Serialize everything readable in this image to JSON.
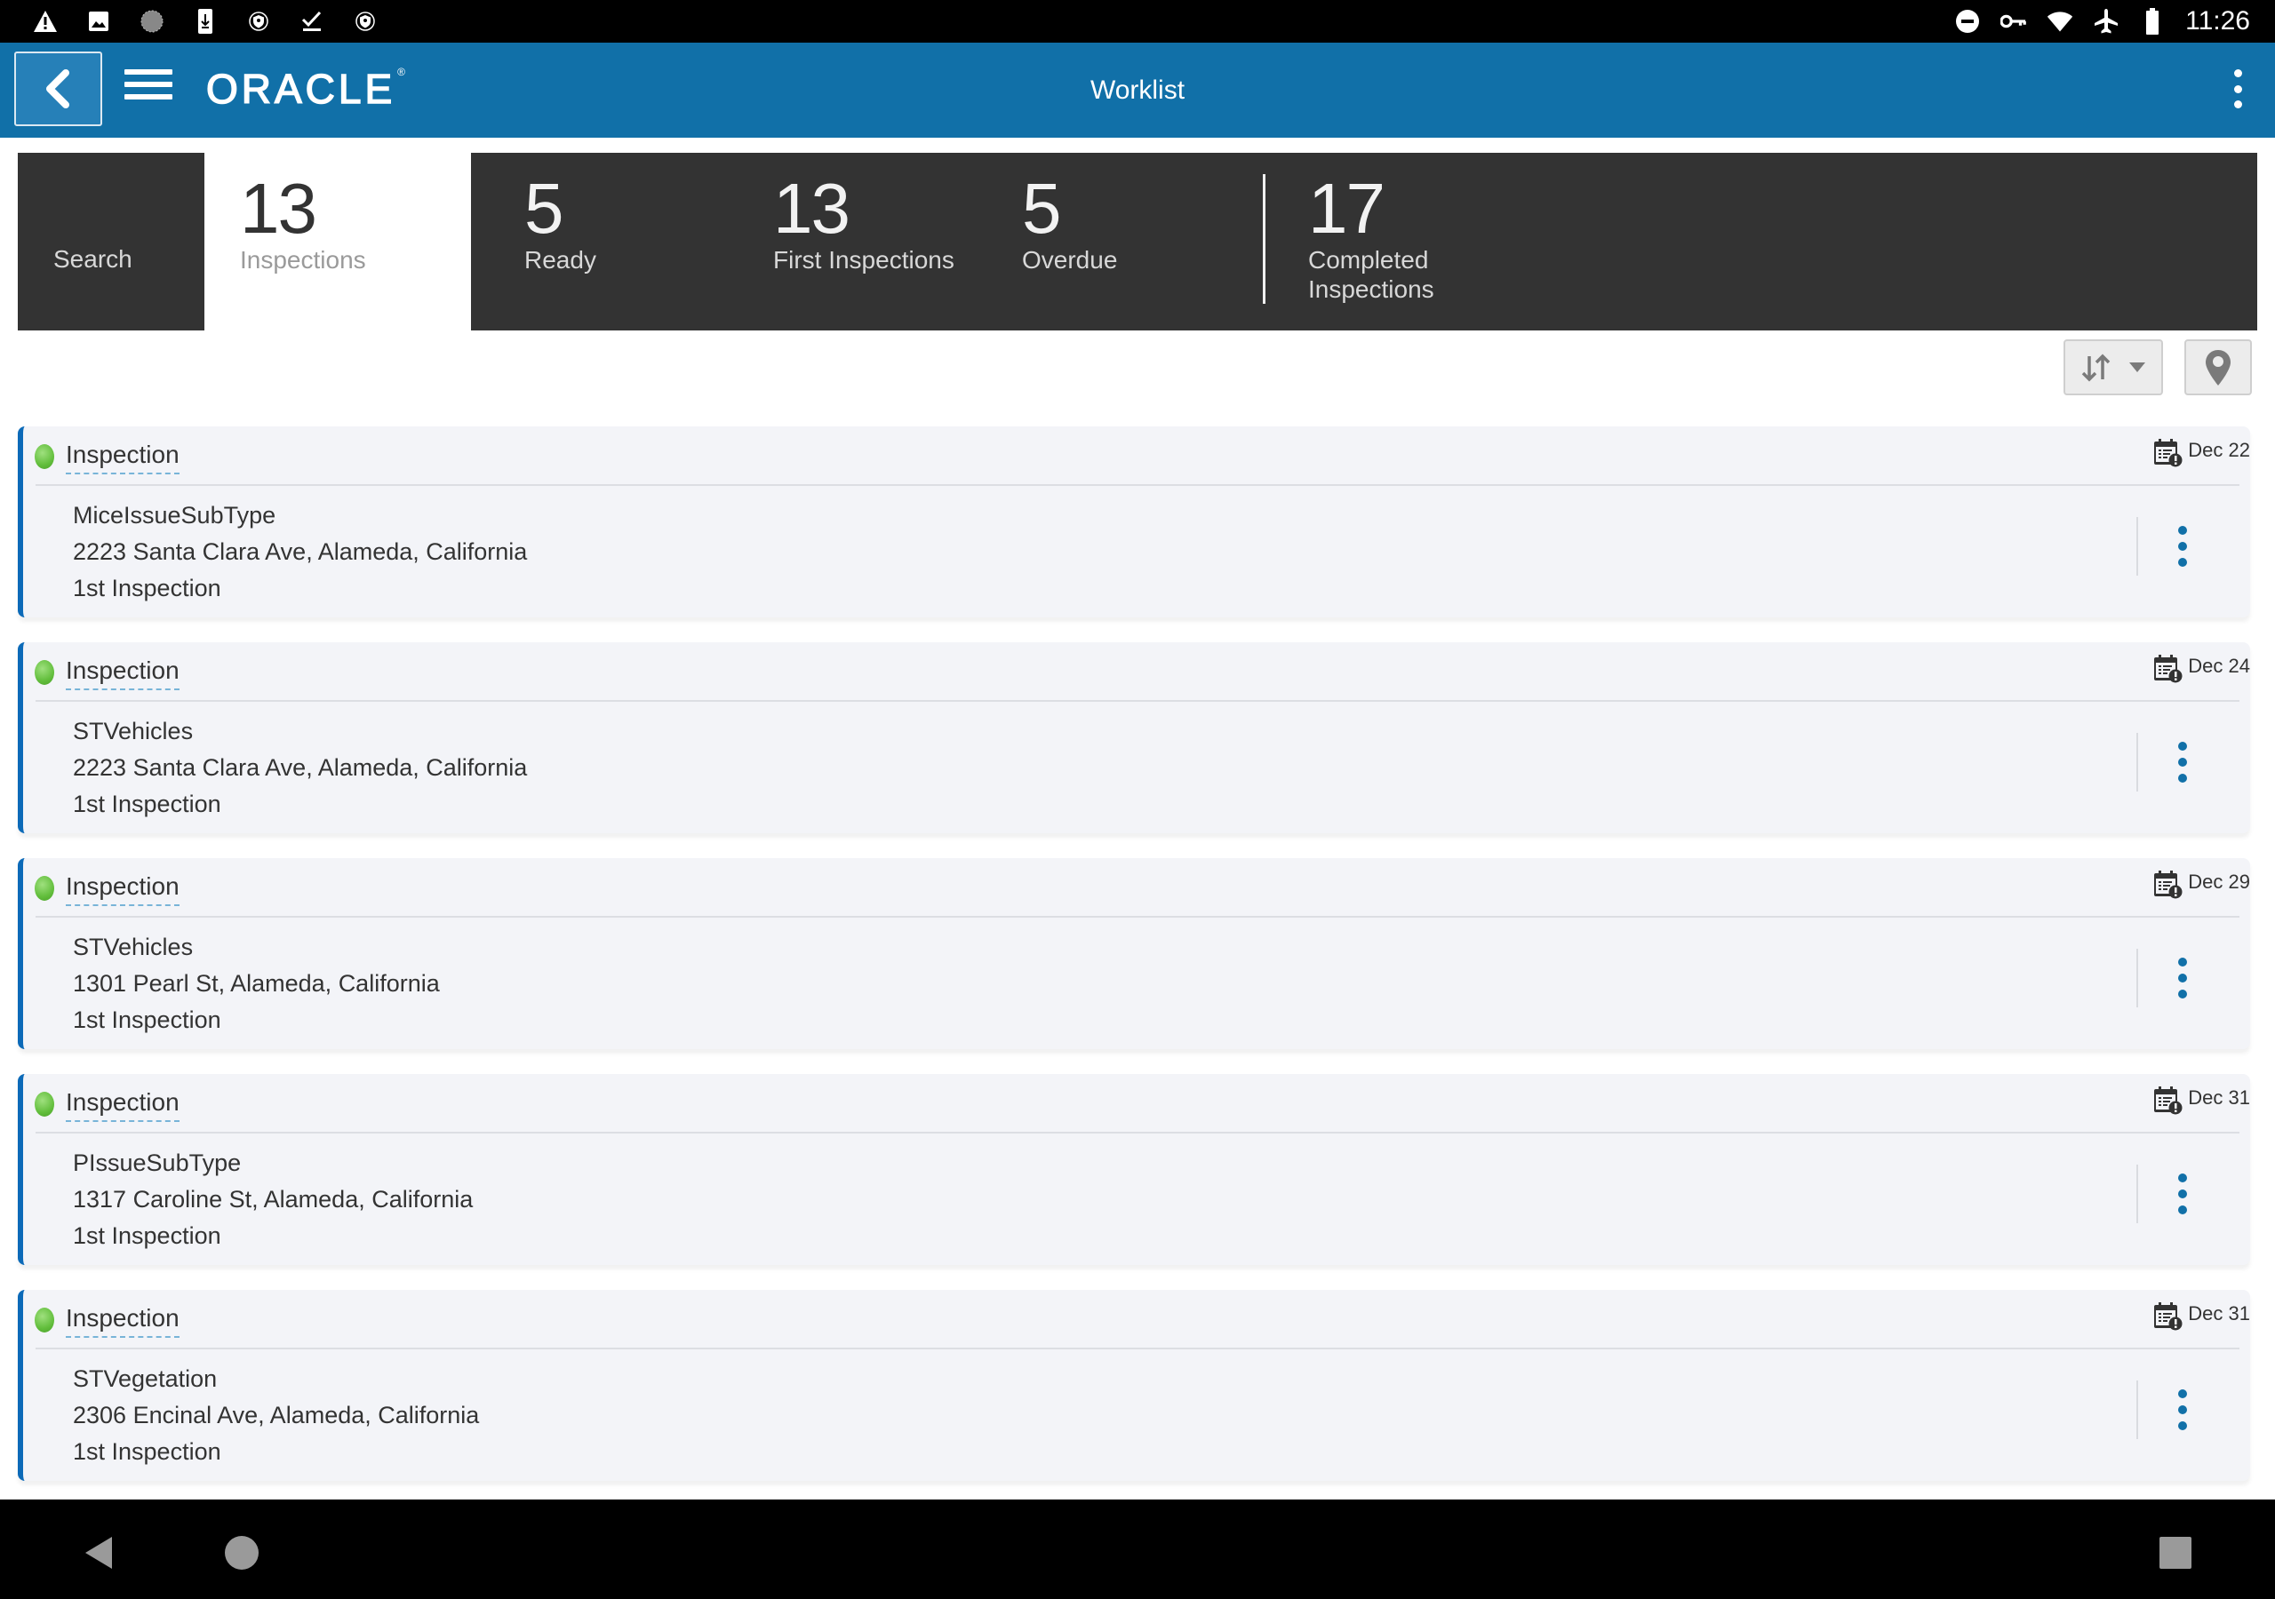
{
  "status_bar": {
    "left_icons": [
      "warning-icon",
      "image-icon",
      "sync-icon",
      "download-icon",
      "vpn-shield-icon",
      "check-icon",
      "vpn-shield-icon"
    ],
    "right_icons": [
      "do-not-disturb-icon",
      "vpn-key-icon",
      "wifi-icon",
      "airplane-icon",
      "battery-icon"
    ],
    "time": "11:26"
  },
  "header": {
    "back_icon": "chevron-left-icon",
    "menu_icon": "hamburger-icon",
    "logo_text": "ORACLE",
    "logo_mark": "®",
    "title": "Worklist",
    "more_icon": "kebab-icon"
  },
  "stats": {
    "search_label": "Search",
    "tiles": [
      {
        "value": "13",
        "label": "Inspections",
        "active": true
      },
      {
        "value": "5",
        "label": "Ready",
        "active": false
      },
      {
        "value": "13",
        "label": "First Inspections",
        "active": false
      },
      {
        "value": "5",
        "label": "Overdue",
        "active": false
      },
      {
        "value": "17",
        "label_line1": "Completed",
        "label_line2": "Inspections",
        "active": false
      }
    ]
  },
  "toolbar": {
    "sort_icon": "sort-icon",
    "sort_dropdown_icon": "caret-down-icon",
    "map_icon": "map-pin-icon"
  },
  "colors": {
    "header": "#1170a8",
    "stats_bg": "#333333",
    "card_accent": "#0c6ab8",
    "status_dot": "#62be3c",
    "kebab": "#1170a8"
  },
  "items": [
    {
      "type": "Inspection",
      "date": "Dec 22",
      "subtype": "MiceIssueSubType",
      "address": "2223 Santa Clara Ave, Alameda, California",
      "stage": "1st Inspection",
      "status": "green"
    },
    {
      "type": "Inspection",
      "date": "Dec 24",
      "subtype": "STVehicles",
      "address": "2223 Santa Clara Ave, Alameda, California",
      "stage": "1st Inspection",
      "status": "green"
    },
    {
      "type": "Inspection",
      "date": "Dec 29",
      "subtype": "STVehicles",
      "address": "1301 Pearl St, Alameda, California",
      "stage": "1st Inspection",
      "status": "green"
    },
    {
      "type": "Inspection",
      "date": "Dec 31",
      "subtype": "PIssueSubType",
      "address": "1317 Caroline St, Alameda, California",
      "stage": "1st Inspection",
      "status": "green"
    },
    {
      "type": "Inspection",
      "date": "Dec 31",
      "subtype": "STVegetation",
      "address": "2306 Encinal Ave, Alameda, California",
      "stage": "1st Inspection",
      "status": "green"
    }
  ],
  "nav_bar": {
    "back_icon": "nav-back-icon",
    "home_icon": "nav-home-icon",
    "recents_icon": "nav-recents-icon"
  }
}
